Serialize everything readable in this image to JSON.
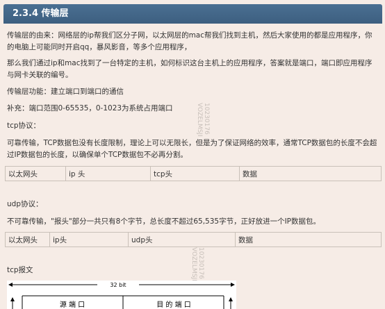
{
  "header": {
    "title": "2.3.4 传输层"
  },
  "paragraphs": {
    "p1": "传输层的由来：网络层的ip帮我们区分子网，以太网层的mac帮我们找到主机，然后大家使用的都是应用程序，你的电脑上可能同时开启qq，暴风影音，等多个应用程序，",
    "p2": "那么我们通过ip和mac找到了一台特定的主机，如何标识这台主机上的应用程序，答案就是端口，端口即应用程序与网卡关联的编号。",
    "p3": "传输层功能：建立端口到端口的通信",
    "p4": "补充：端口范围0-65535，0-1023为系统占用端口",
    "tcp_label": "tcp协议：",
    "tcp_desc": "可靠传输，TCP数据包没有长度限制，理论上可以无限长，但是为了保证网络的效率，通常TCP数据包的长度不会超过IP数据包的长度，以确保单个TCP数据包不必再分割。",
    "udp_label": "udp协议：",
    "udp_desc": "不可靠传输，\"报头\"部分一共只有8个字节，总长度不超过65,535字节，正好放进一个IP数据包。",
    "tcp_packet_label": "tcp报文"
  },
  "tcp_table": [
    "以太网头",
    "ip 头",
    "tcp头",
    "数据"
  ],
  "udp_table": [
    "以太网头",
    "ip头",
    "udp头",
    "数据"
  ],
  "diagram": {
    "width_label": "32 bit",
    "left_field": "源 端 口",
    "right_field": "目 的 端 口"
  },
  "watermark": {
    "line1": "10230176",
    "line2": "VOZELMSJI"
  }
}
